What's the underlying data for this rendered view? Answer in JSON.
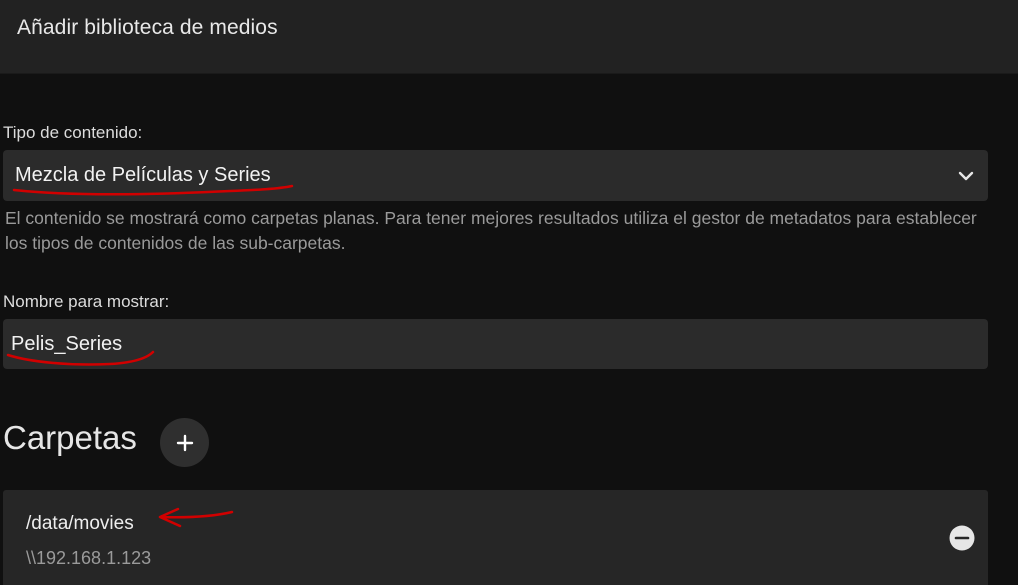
{
  "dialog": {
    "title": "Añadir biblioteca de medios"
  },
  "content_type": {
    "label": "Tipo de contenido:",
    "selected": "Mezcla de Películas y Series",
    "description": "El contenido se mostrará como carpetas planas. Para tener mejores resultados utiliza el gestor de metadatos para establecer los tipos de contenidos de las sub-carpetas."
  },
  "display_name": {
    "label": "Nombre para mostrar:",
    "value": "Pelis_Series"
  },
  "folders": {
    "title": "Carpetas",
    "add_symbol": "+",
    "items": [
      {
        "path": "/data/movies",
        "network_path": "\\\\192.168.1.123"
      }
    ]
  },
  "colors": {
    "background": "#101010",
    "header": "#222222",
    "field_background": "#2b2b2b",
    "annotation": "#d10000"
  }
}
